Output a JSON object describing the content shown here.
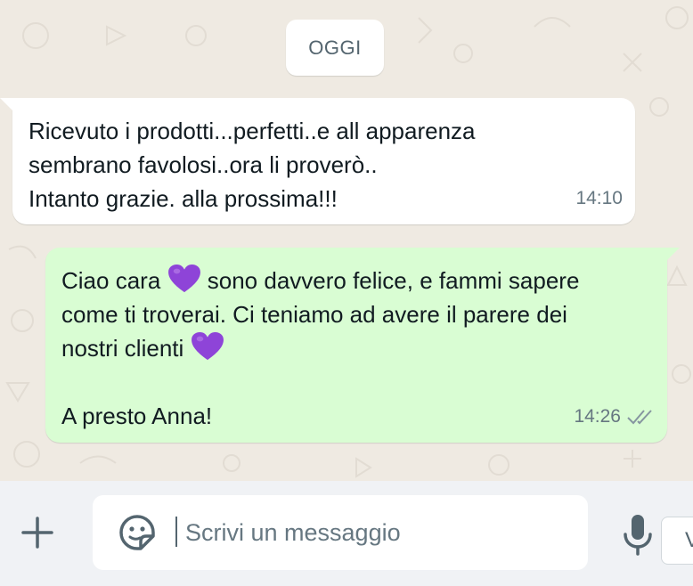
{
  "chat": {
    "date_chip": "OGGI",
    "messages": [
      {
        "direction": "incoming",
        "lines": [
          "Ricevuto i prodotti...perfetti..e all apparenza",
          "sembrano favolosi..ora li proverò..",
          "Intanto grazie. alla prossima!!!"
        ],
        "time": "14:10"
      },
      {
        "direction": "outgoing",
        "line1_a": "Ciao cara",
        "line1_b": "sono davvero felice, e fammi sapere",
        "line2": "come ti troverai. Ci teniamo ad avere il parere dei",
        "line3": "nostri clienti",
        "line5": "A presto Anna!",
        "time": "14:26",
        "status_icon": "double-check-icon",
        "emoji": "purple-heart"
      }
    ]
  },
  "composer": {
    "placeholder": "Scrivi un messaggio",
    "value": "",
    "side_label": "V"
  },
  "colors": {
    "chat_bg": "#efeae2",
    "incoming_bubble": "#ffffff",
    "outgoing_bubble": "#d9fdd3",
    "meta_text": "#667781",
    "composer_bg": "#f0f2f5",
    "heart": "#8e44d8"
  }
}
